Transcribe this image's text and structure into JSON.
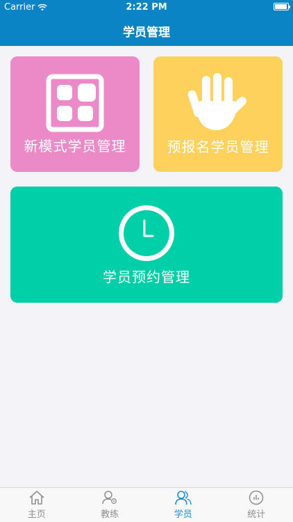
{
  "status": {
    "carrier": "Carrier",
    "time": "2:22 PM"
  },
  "nav": {
    "title": "学员管理"
  },
  "tiles": [
    {
      "label": "新模式学员管理",
      "icon": "grid-icon",
      "color": "#ec8ac8"
    },
    {
      "label": "预报名学员管理",
      "icon": "hand-icon",
      "color": "#fdd15b"
    },
    {
      "label": "学员预约管理",
      "icon": "clock-icon",
      "color": "#00cfa7"
    }
  ],
  "tabbar": {
    "items": [
      {
        "label": "主页",
        "icon": "home-icon"
      },
      {
        "label": "教练",
        "icon": "coach-icon"
      },
      {
        "label": "学员",
        "icon": "student-icon",
        "active": true
      },
      {
        "label": "统计",
        "icon": "stats-icon"
      }
    ]
  },
  "colors": {
    "nav": "#0b84c6",
    "active_tab": "#1a8fd5"
  }
}
